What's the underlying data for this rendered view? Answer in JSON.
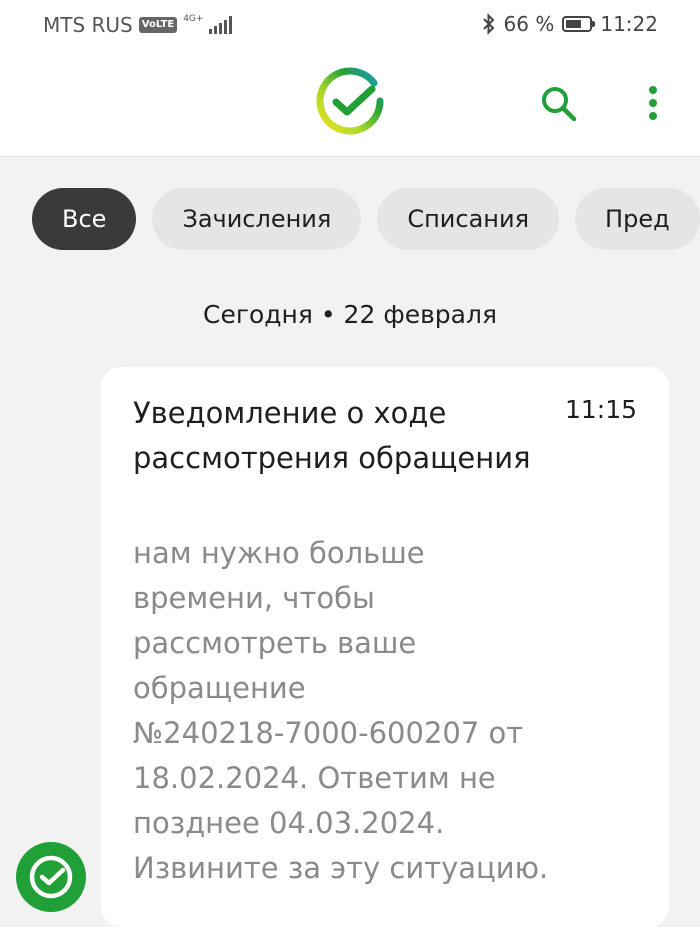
{
  "status_bar": {
    "carrier": "MTS RUS",
    "volte": "VoLTE",
    "network": "4G+",
    "battery": "66 %",
    "battery_level": 0.66,
    "time": "11:22",
    "icons": [
      "signal-icon",
      "bluetooth-icon",
      "battery-icon"
    ]
  },
  "header": {
    "logo": "sber-logo",
    "actions": [
      "search-icon",
      "more-vert-icon"
    ]
  },
  "filters": {
    "chips": [
      {
        "label": "Все",
        "active": true
      },
      {
        "label": "Зачисления",
        "active": false
      },
      {
        "label": "Списания",
        "active": false
      },
      {
        "label": "Пред",
        "active": false
      }
    ]
  },
  "feed": {
    "date_header": "Сегодня • 22 февраля",
    "message": {
      "title": "Уведомление о ходе рассмотрения обращения",
      "time": "11:15",
      "body": "нам нужно больше\nвремени, чтобы\nрассмотреть ваше\nобращение\n№240218-7000-600207 от\n18.02.2024. Ответим не\nпозднее 04.03.2024.\nИзвините за эту ситуацию."
    }
  },
  "colors": {
    "brand_green": "#21a038",
    "active_chip": "#3a3a3a",
    "chip": "#e5e5e5",
    "background": "#f2f2f2"
  }
}
